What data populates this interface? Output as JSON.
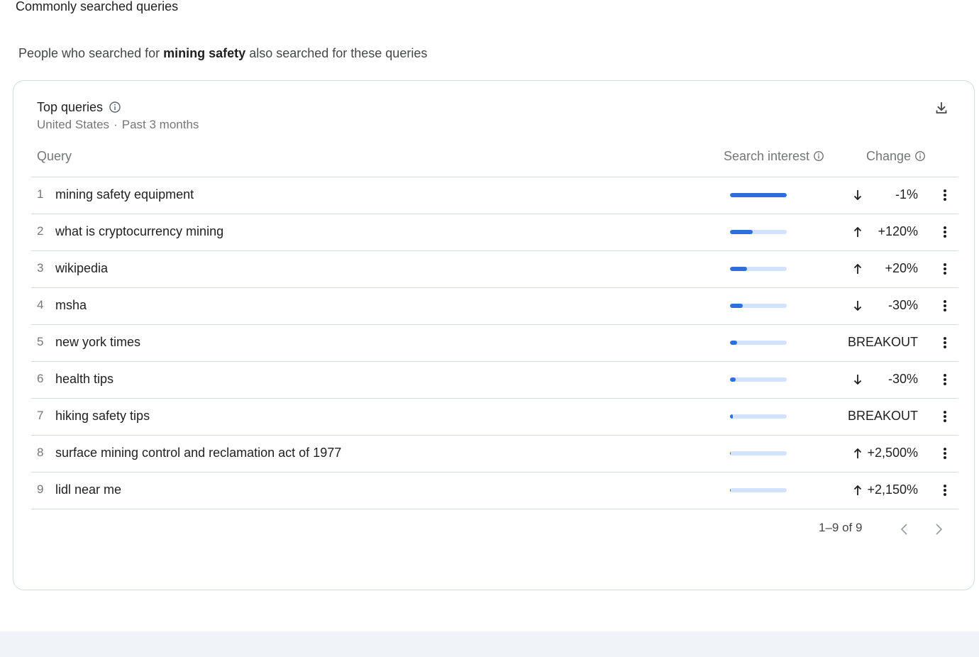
{
  "section": {
    "title": "Commonly searched queries",
    "intro_prefix": "People who searched for",
    "intro_term": "mining safety",
    "intro_suffix": "also searched for these queries"
  },
  "card": {
    "title": "Top queries",
    "region": "United States",
    "separator": "·",
    "period": "Past 3 months",
    "icons": {
      "info": "info-icon",
      "download": "download-icon"
    }
  },
  "table": {
    "headers": {
      "query": "Query",
      "interest": "Search interest",
      "change": "Change"
    },
    "rows": [
      {
        "rank": "1",
        "query": "mining safety equipment",
        "interest": 100,
        "direction": "down",
        "change": "-1%"
      },
      {
        "rank": "2",
        "query": "what is cryptocurrency mining",
        "interest": 40,
        "direction": "up",
        "change": "+120%"
      },
      {
        "rank": "3",
        "query": "wikipedia",
        "interest": 30,
        "direction": "up",
        "change": "+20%"
      },
      {
        "rank": "4",
        "query": "msha",
        "interest": 22,
        "direction": "down",
        "change": "-30%"
      },
      {
        "rank": "5",
        "query": "new york times",
        "interest": 13,
        "direction": "none",
        "change": "BREAKOUT"
      },
      {
        "rank": "6",
        "query": "health tips",
        "interest": 10,
        "direction": "down",
        "change": "-30%"
      },
      {
        "rank": "7",
        "query": "hiking safety tips",
        "interest": 5,
        "direction": "none",
        "change": "BREAKOUT"
      },
      {
        "rank": "8",
        "query": "surface mining control and reclamation act of 1977",
        "interest": 1,
        "direction": "up",
        "change": "+2,500%"
      },
      {
        "rank": "9",
        "query": "lidl near me",
        "interest": 1,
        "direction": "up",
        "change": "+2,150%"
      }
    ]
  },
  "pagination": {
    "label": "1–9 of 9"
  },
  "colors": {
    "bar_fill": "#2e6fe0",
    "bar_track": "#d3e3fd",
    "border": "#d3dbe6"
  }
}
